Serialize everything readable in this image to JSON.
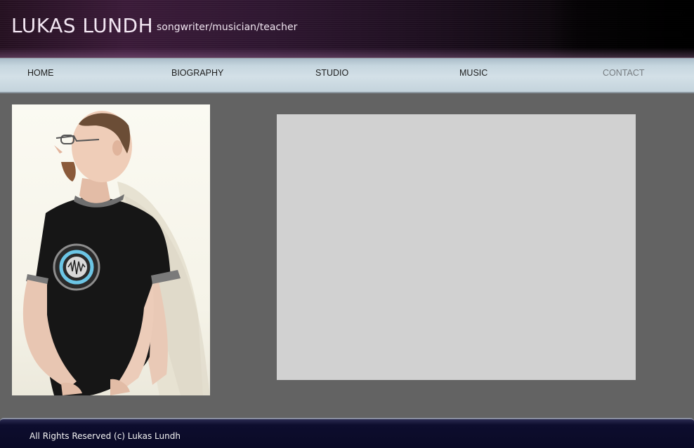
{
  "header": {
    "title": "LUKAS LUNDH",
    "tagline": "songwriter/musician/teacher"
  },
  "nav": {
    "items": [
      {
        "label": "HOME"
      },
      {
        "label": "BIOGRAPHY"
      },
      {
        "label": "STUDIO"
      },
      {
        "label": "MUSIC"
      },
      {
        "label": "CONTACT"
      }
    ],
    "active": "CONTACT"
  },
  "colors": {
    "background": "#636363",
    "nav_text": "#1e1e1e",
    "nav_active_text": "#767c80",
    "placeholder": "#d1d1d1",
    "footer_bg": "#0a0a26"
  },
  "footer": {
    "copyright": "All Rights Reserved (c) Lukas Lundh"
  }
}
